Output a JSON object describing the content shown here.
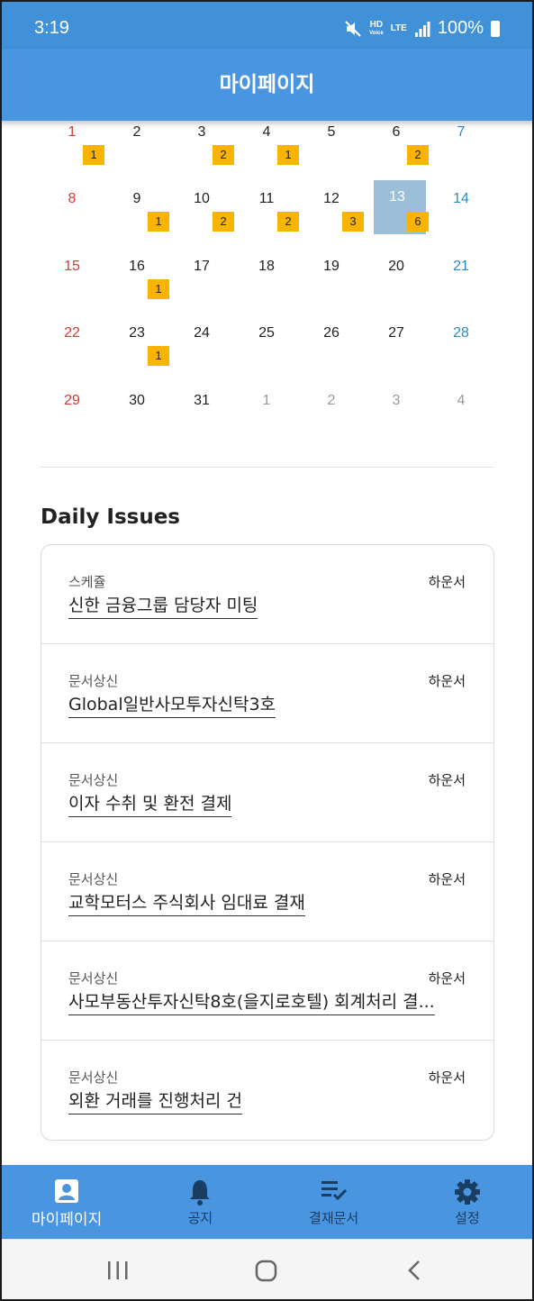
{
  "status_bar": {
    "time": "3:19",
    "hd_label": "HD",
    "voice_label": "Voice",
    "lte_label": "LTE",
    "battery_text": "100%",
    "icons": [
      "mute-icon",
      "signal-icon",
      "battery-icon"
    ]
  },
  "header": {
    "title": "마이페이지"
  },
  "calendar": {
    "days": [
      {
        "day": "1",
        "badge": "1",
        "kind": "sun"
      },
      {
        "day": "2",
        "badge": "",
        "kind": "weekday"
      },
      {
        "day": "3",
        "badge": "2",
        "kind": "weekday"
      },
      {
        "day": "4",
        "badge": "1",
        "kind": "weekday"
      },
      {
        "day": "5",
        "badge": "",
        "kind": "weekday"
      },
      {
        "day": "6",
        "badge": "2",
        "kind": "weekday"
      },
      {
        "day": "7",
        "badge": "",
        "kind": "sat"
      },
      {
        "day": "8",
        "badge": "",
        "kind": "sun"
      },
      {
        "day": "9",
        "badge": "1",
        "kind": "weekday"
      },
      {
        "day": "10",
        "badge": "2",
        "kind": "weekday"
      },
      {
        "day": "11",
        "badge": "2",
        "kind": "weekday"
      },
      {
        "day": "12",
        "badge": "3",
        "kind": "weekday"
      },
      {
        "day": "13",
        "badge": "6",
        "kind": "weekday",
        "selected": true
      },
      {
        "day": "14",
        "badge": "",
        "kind": "sat"
      },
      {
        "day": "15",
        "badge": "",
        "kind": "sun"
      },
      {
        "day": "16",
        "badge": "1",
        "kind": "weekday"
      },
      {
        "day": "17",
        "badge": "",
        "kind": "weekday"
      },
      {
        "day": "18",
        "badge": "",
        "kind": "weekday"
      },
      {
        "day": "19",
        "badge": "",
        "kind": "weekday"
      },
      {
        "day": "20",
        "badge": "",
        "kind": "weekday"
      },
      {
        "day": "21",
        "badge": "",
        "kind": "sat"
      },
      {
        "day": "22",
        "badge": "",
        "kind": "sun"
      },
      {
        "day": "23",
        "badge": "1",
        "kind": "weekday"
      },
      {
        "day": "24",
        "badge": "",
        "kind": "weekday"
      },
      {
        "day": "25",
        "badge": "",
        "kind": "weekday"
      },
      {
        "day": "26",
        "badge": "",
        "kind": "weekday"
      },
      {
        "day": "27",
        "badge": "",
        "kind": "weekday"
      },
      {
        "day": "28",
        "badge": "",
        "kind": "sat"
      },
      {
        "day": "29",
        "badge": "",
        "kind": "sun"
      },
      {
        "day": "30",
        "badge": "",
        "kind": "weekday"
      },
      {
        "day": "31",
        "badge": "",
        "kind": "weekday"
      },
      {
        "day": "1",
        "badge": "",
        "kind": "other"
      },
      {
        "day": "2",
        "badge": "",
        "kind": "other"
      },
      {
        "day": "3",
        "badge": "",
        "kind": "other"
      },
      {
        "day": "4",
        "badge": "",
        "kind": "other"
      }
    ],
    "colors": {
      "sunday": "#d43c34",
      "saturday": "#2b8ac6",
      "badge": "#f8b400",
      "selected": "#9bbfd9"
    }
  },
  "daily_issues": {
    "title": "Daily Issues",
    "items": [
      {
        "category": "스케쥴",
        "author": "하운서",
        "title": "신한 금융그룹 담당자 미팅"
      },
      {
        "category": "문서상신",
        "author": "하운서",
        "title": "Global일반사모투자신탁3호"
      },
      {
        "category": "문서상신",
        "author": "하운서",
        "title": "이자 수취 및 환전 결제"
      },
      {
        "category": "문서상신",
        "author": "하운서",
        "title": "교학모터스 주식회사 임대료 결재"
      },
      {
        "category": "문서상신",
        "author": "하운서",
        "title": "사모부동산투자신탁8호(을지로호텔) 회계처리 결..."
      },
      {
        "category": "문서상신",
        "author": "하운서",
        "title": "외환 거래를 진행처리 건"
      }
    ]
  },
  "bottom_nav": {
    "items": [
      {
        "label": "마이페이지",
        "icon": "person-icon",
        "active": true
      },
      {
        "label": "공지",
        "icon": "bell-icon",
        "active": false
      },
      {
        "label": "결재문서",
        "icon": "playlist-check-icon",
        "active": false
      },
      {
        "label": "설정",
        "icon": "gear-icon",
        "active": false
      }
    ]
  },
  "system_nav": {
    "icons": [
      "recent-apps-icon",
      "home-icon",
      "back-icon"
    ]
  },
  "theme": {
    "primary": "#4a95e0",
    "status_bar": "#4091d8",
    "inactive_nav_label": "#1a3d62"
  }
}
